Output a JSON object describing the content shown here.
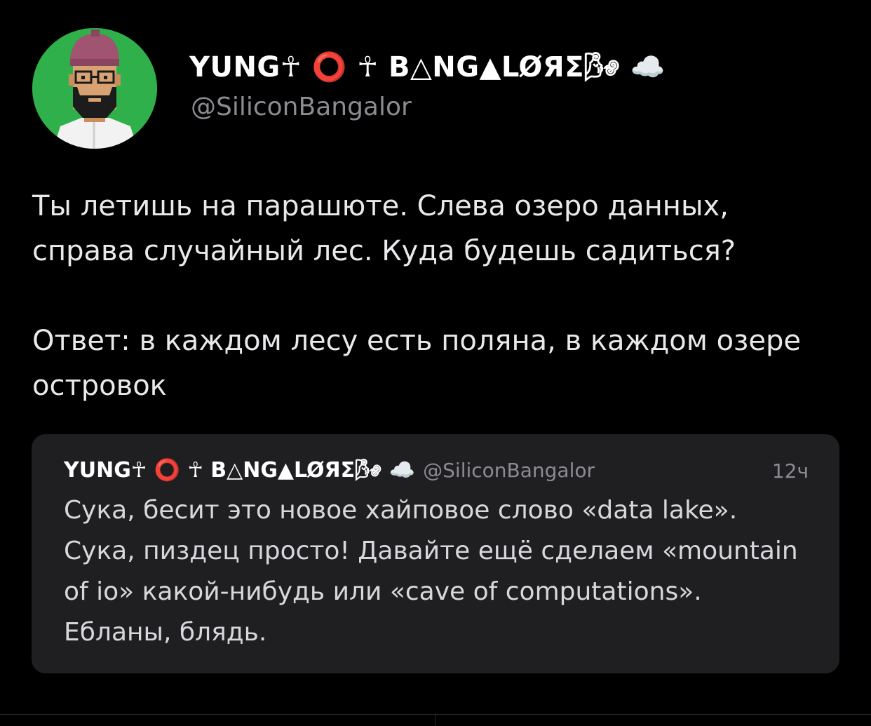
{
  "author": {
    "display_name": "YUNG☥ ⭕ ☥ B△NG▲LØЯΣ🌬 ☁️",
    "handle": "@SiliconBangalor",
    "avatar_icon": "pixel-art-bearded-man-avatar-icon",
    "avatar_bg": "#2fb04a"
  },
  "tweet": {
    "paragraphs": [
      "Ты летишь на парашюте. Слева озеро данных, справа случайный лес. Куда будешь садиться?",
      "Ответ: в каждом лесу есть поляна, в каждом озере островок"
    ]
  },
  "quoted_tweet": {
    "display_name": "YUNG☥ ⭕ ☥ B△NG▲LØЯΣ🌬 ☁️",
    "handle": "@SiliconBangalor",
    "time": "12ч",
    "text": "Сука, бесит это новое хайповое слово «data lake». Сука, пиздец просто! Давайте ещё сделаем «mountain of io» какой-нибудь или «cave of computations». Ебланы, блядь."
  },
  "colors": {
    "background": "#000000",
    "card": "#1f1f22",
    "secondary_text": "#8b8b91",
    "primary_text": "#ffffff"
  }
}
